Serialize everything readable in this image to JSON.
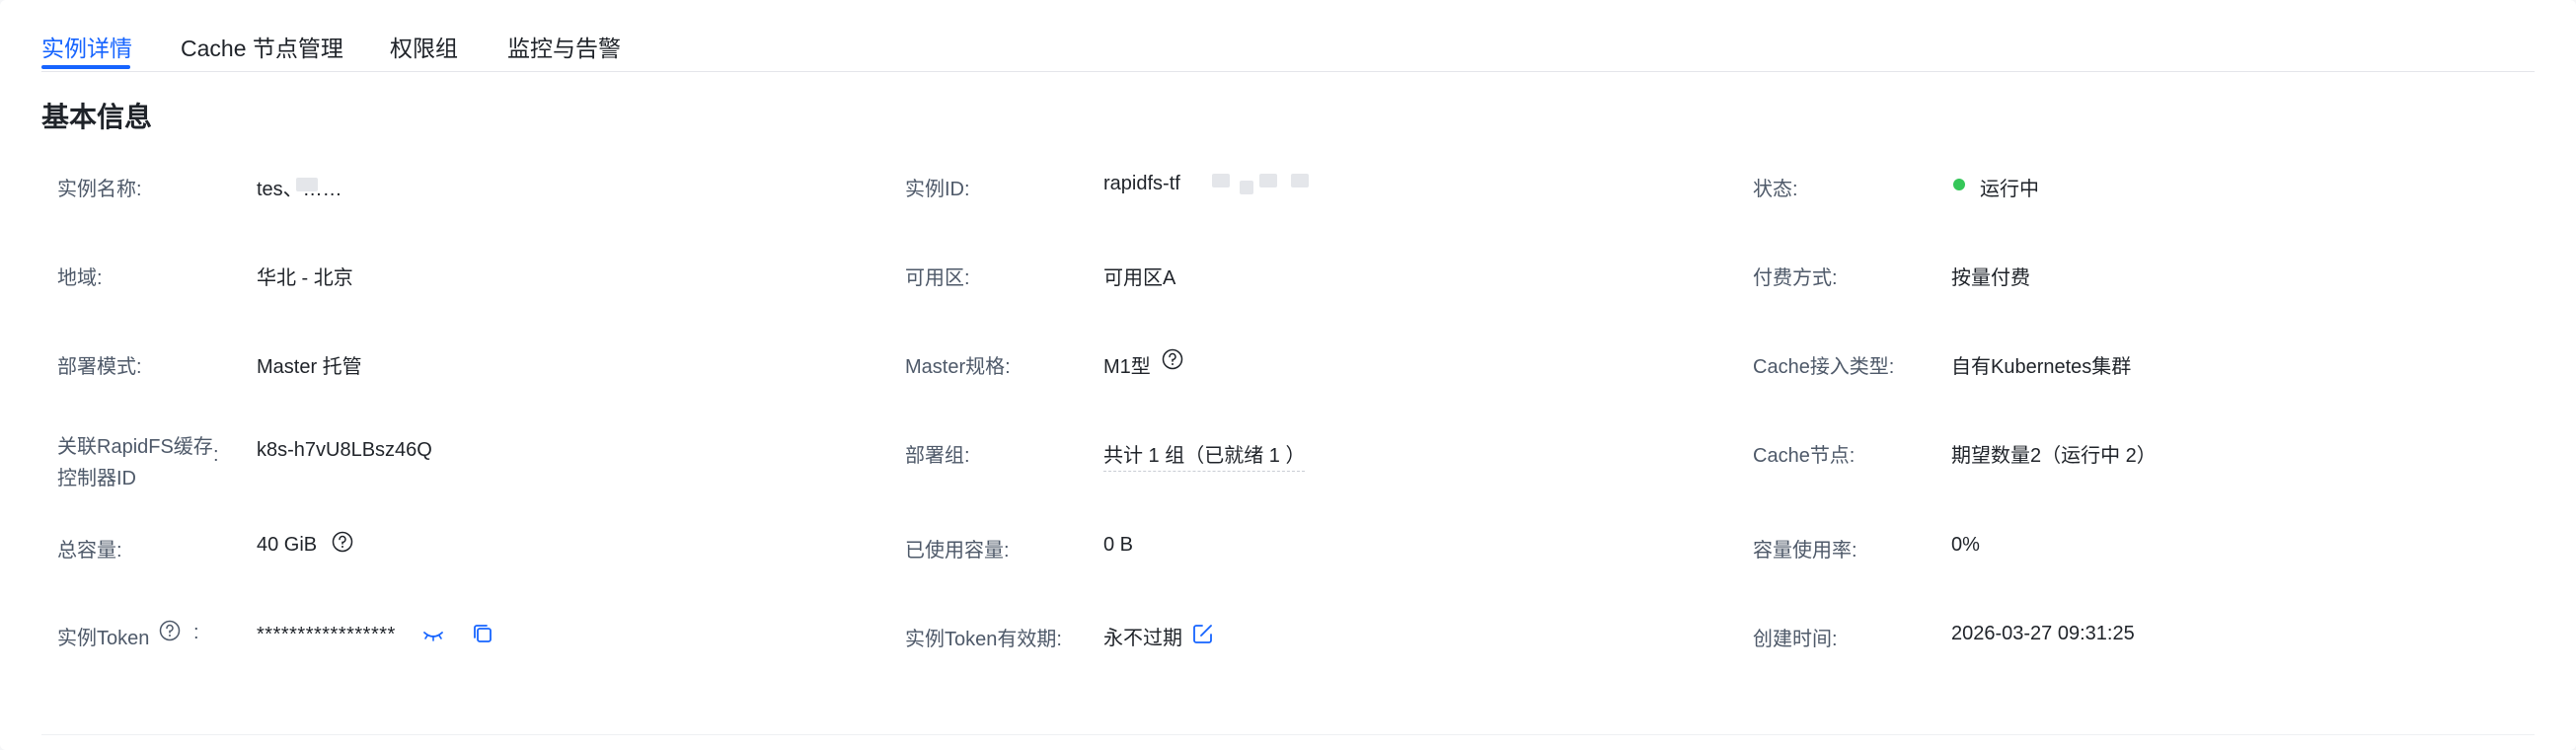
{
  "tabs": [
    {
      "label": "实例详情",
      "active": true
    },
    {
      "label": "Cache 节点管理",
      "active": false
    },
    {
      "label": "权限组",
      "active": false
    },
    {
      "label": "监控与告警",
      "active": false
    }
  ],
  "section": {
    "title": "基本信息"
  },
  "fields": {
    "instance_name": {
      "label": "实例名称:",
      "value": "tes、……"
    },
    "instance_id": {
      "label": "实例ID:",
      "value": "rapidfs-tf⁠"
    },
    "status": {
      "label": "状态:",
      "value": "运行中",
      "color": "#35c759"
    },
    "region": {
      "label": "地域:",
      "value": "华北 - 北京"
    },
    "zone": {
      "label": "可用区:",
      "value": "可用区A"
    },
    "billing": {
      "label": "付费方式:",
      "value": "按量付费"
    },
    "deploy_mode": {
      "label": "部署模式:",
      "value": "Master 托管"
    },
    "master_spec": {
      "label": "Master规格:",
      "value": "M1型"
    },
    "cache_access_type": {
      "label": "Cache接入类型:",
      "value": "自有Kubernetes集群"
    },
    "controller_id": {
      "label_line1": "关联RapidFS缓存",
      "label_line2": "控制器ID",
      "colon": ":",
      "value": "k8s-h7vU8LBsz46Q"
    },
    "deploy_group": {
      "label": "部署组:",
      "value": "共计 1 组（已就绪 1 ）"
    },
    "cache_nodes": {
      "label": "Cache节点:",
      "value": "期望数量2（运行中 2）"
    },
    "total_capacity": {
      "label": "总容量:",
      "value": "40 GiB"
    },
    "used_capacity": {
      "label": "已使用容量:",
      "value": "0 B"
    },
    "usage_rate": {
      "label": "容量使用率:",
      "value": "0%"
    },
    "token": {
      "label": "实例Token",
      "colon": ":",
      "value": "*****************"
    },
    "token_validity": {
      "label": "实例Token有效期:",
      "value": "永不过期"
    },
    "created_at": {
      "label": "创建时间:",
      "value": "2026-03-27 09:31:25"
    }
  },
  "accent_color": "#1664ff",
  "icons": [
    "help-icon",
    "eye-closed-icon",
    "copy-icon",
    "edit-icon",
    "status-dot"
  ]
}
